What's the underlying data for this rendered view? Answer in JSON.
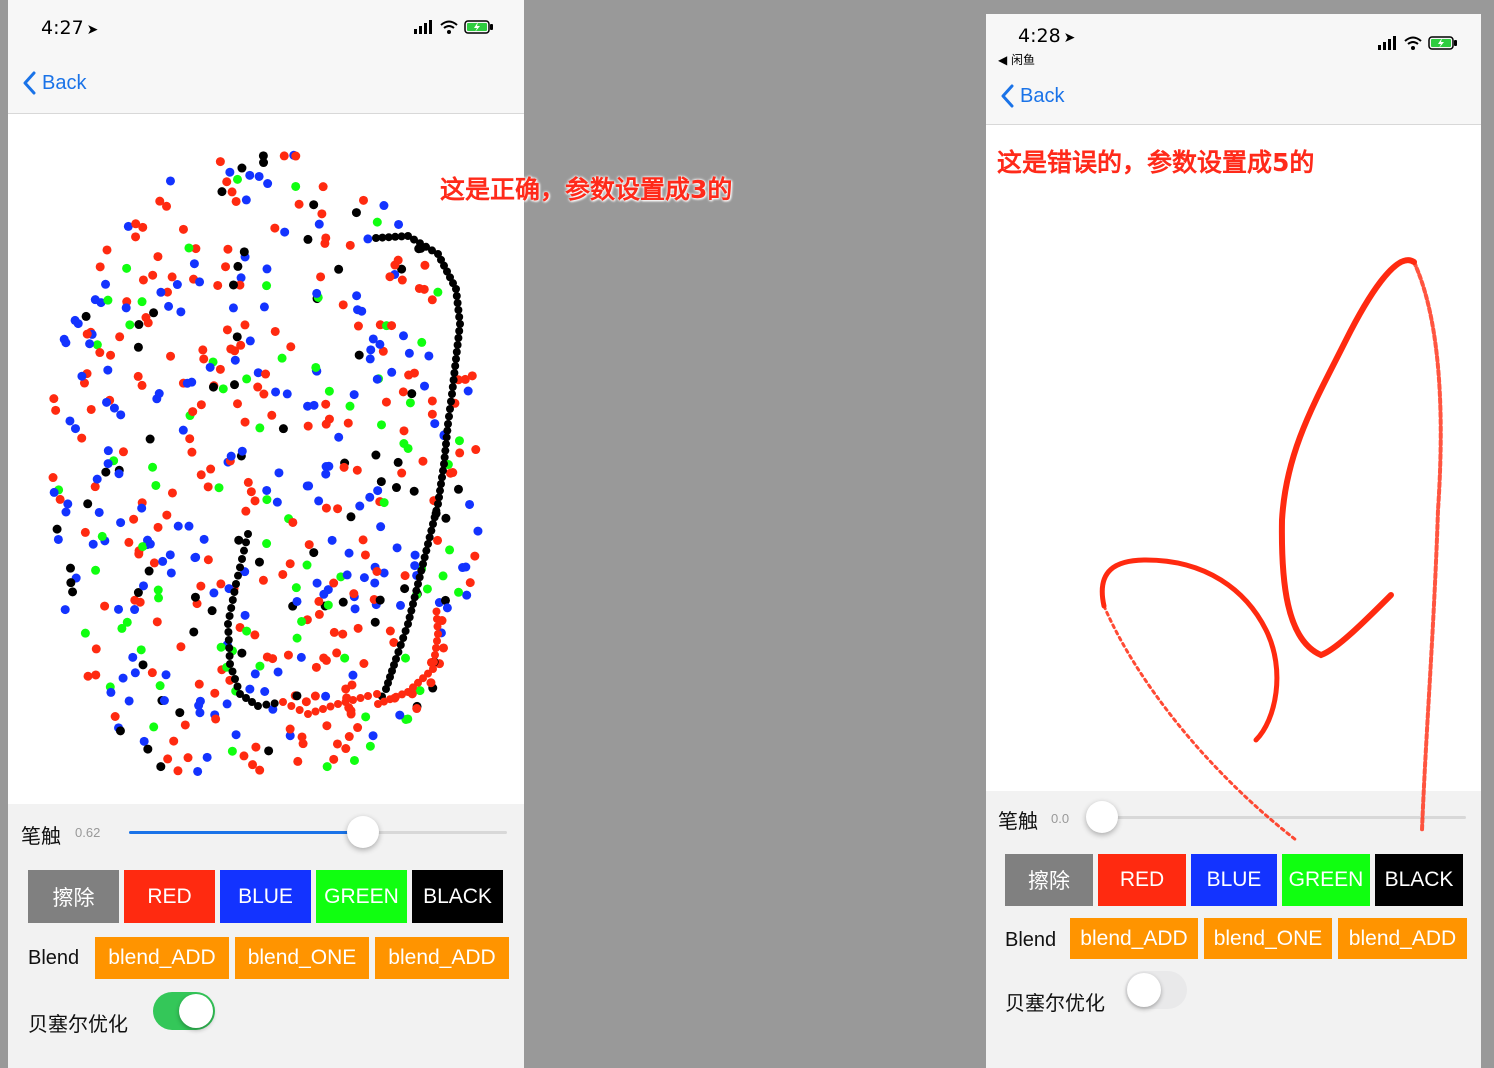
{
  "left": {
    "time": "4:27",
    "back_label": "Back",
    "annotation": "这是正确，参数设置成3的",
    "brush_label": "笔触",
    "brush_value": "0.62",
    "brush_fraction": 0.62,
    "erase_label": "擦除",
    "color_buttons": [
      "RED",
      "BLUE",
      "GREEN",
      "BLACK"
    ],
    "blend_label": "Blend",
    "blend_buttons": [
      "blend_ADD",
      "blend_ONE",
      "blend_ADD"
    ],
    "bezier_label": "贝塞尔优化",
    "bezier_on": true
  },
  "right": {
    "time": "4:28",
    "carrier_back": "◀ 闲鱼",
    "back_label": "Back",
    "annotation": "这是错误的，参数设置成5的",
    "brush_label": "笔触",
    "brush_value": "0.0",
    "brush_fraction": 0.0,
    "erase_label": "擦除",
    "color_buttons": [
      "RED",
      "BLUE",
      "GREEN",
      "BLACK"
    ],
    "blend_label": "Blend",
    "blend_buttons": [
      "blend_ADD",
      "blend_ONE",
      "blend_ADD"
    ],
    "bezier_label": "贝塞尔优化",
    "bezier_on": false
  },
  "colors": {
    "red": "#ff2a10",
    "blue": "#1333ff",
    "green": "#10ff10",
    "black": "#000000",
    "gray": "#808080",
    "orange": "#ff9400",
    "accent": "#1a73e8",
    "toggle_on": "#34c759"
  }
}
